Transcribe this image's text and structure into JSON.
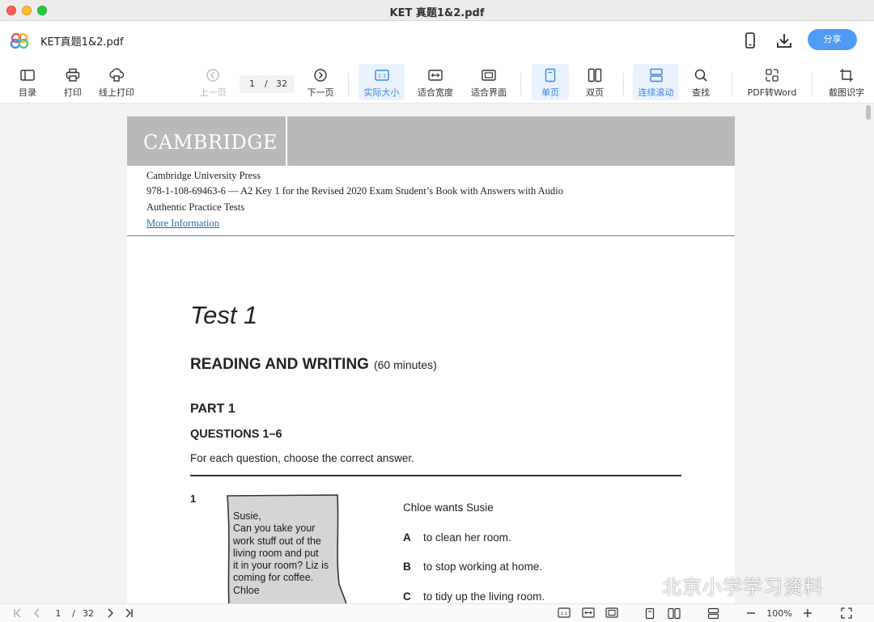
{
  "window": {
    "title": "KET 真题1&2.pdf"
  },
  "header": {
    "doc_title": "KET真题1&2.pdf",
    "share_label": "分享",
    "icons": [
      "app-logo",
      "mobile-icon",
      "download-icon"
    ]
  },
  "toolbar": {
    "toc": "目录",
    "print": "打印",
    "online_print": "线上打印",
    "prev_page": "上一页",
    "current_page": "1",
    "separator": "/",
    "total_pages": "32",
    "next_page": "下一页",
    "actual_size": "实际大小",
    "fit_width": "适合宽度",
    "fit_page": "适合界面",
    "single_page": "单页",
    "double_page": "双页",
    "continuous_scroll": "连续滚动",
    "find": "查找",
    "pdf_to_word": "PDF转Word",
    "ocr": "截图识字",
    "active_items": [
      "actual_size",
      "single_page",
      "continuous_scroll"
    ]
  },
  "document": {
    "publisher_logo": "CAMBRIDGE",
    "publisher": "Cambridge University Press",
    "isbn_line": "978-1-108-69463-6 — A2 Key 1 for the Revised 2020 Exam Student’s Book with Answers with Audio",
    "series": "Authentic Practice Tests",
    "more_info": "More Information",
    "test_title": "Test 1",
    "section_title": "READING AND WRITING",
    "section_time": "(60 minutes)",
    "part": "PART 1",
    "questions": "QUESTIONS 1–6",
    "instruction": "For each question, choose the correct answer.",
    "question": {
      "number": "1",
      "note_lines": [
        "Susie,",
        "Can you take your",
        "work stuff out of the",
        "living room and put",
        "it in your room? Liz is",
        "coming for coffee.",
        "Chloe"
      ],
      "stem": "Chloe wants Susie",
      "options": [
        {
          "letter": "A",
          "text": "to clean her room."
        },
        {
          "letter": "B",
          "text": "to stop working at home."
        },
        {
          "letter": "C",
          "text": "to tidy up the living room."
        }
      ]
    }
  },
  "watermark": "北京小学学习资料",
  "statusbar": {
    "current_page": "1",
    "separator": "/",
    "total_pages": "32",
    "zoom": "100%",
    "actual_size_badge": "1:1"
  },
  "colors": {
    "accent": "#4f9bf5",
    "active_bg": "#e9f2fe",
    "cambridge_band": "#b9b9b9",
    "link": "#2d67a8"
  }
}
